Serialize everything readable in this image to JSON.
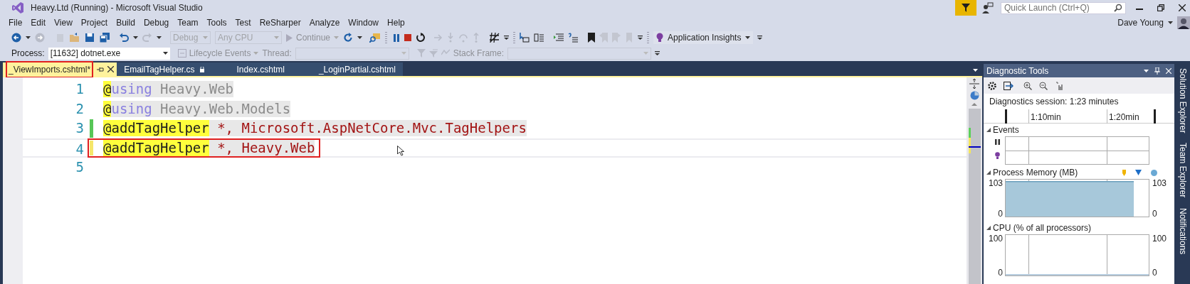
{
  "window": {
    "title": "Heavy.Ltd (Running) - Microsoft Visual Studio"
  },
  "quick_launch": {
    "placeholder": "Quick Launch (Ctrl+Q)"
  },
  "user": {
    "name": "Dave Young"
  },
  "menu": [
    "File",
    "Edit",
    "View",
    "Project",
    "Build",
    "Debug",
    "Team",
    "Tools",
    "Test",
    "ReSharper",
    "Analyze",
    "Window",
    "Help"
  ],
  "toolbar": {
    "configuration": "Debug",
    "platform": "Any CPU",
    "continue": "Continue",
    "insights": "Application Insights"
  },
  "debug_location": {
    "process_label": "Process:",
    "process": "[11632] dotnet.exe",
    "lifecycle": "Lifecycle Events",
    "thread_label": "Thread:",
    "stack_frame_label": "Stack Frame:"
  },
  "tabs": [
    {
      "label": "_ViewImports.cshtml*",
      "selected": true,
      "highlighted": true,
      "locked": false
    },
    {
      "label": "EmailTagHelper.cs",
      "selected": false,
      "highlighted": false,
      "locked": true
    },
    {
      "label": "Index.cshtml",
      "selected": false,
      "highlighted": false,
      "locked": false
    },
    {
      "label": "_LoginPartial.cshtml",
      "selected": false,
      "highlighted": false,
      "locked": false
    }
  ],
  "editor": {
    "lines": [
      {
        "number": "1",
        "highlighted": false,
        "tokens": [
          {
            "kind": "at",
            "text": "@"
          },
          {
            "kind": "keyword",
            "text": "using"
          },
          {
            "kind": "namespace",
            "text": " Heavy.Web"
          }
        ]
      },
      {
        "number": "2",
        "highlighted": false,
        "tokens": [
          {
            "kind": "at",
            "text": "@"
          },
          {
            "kind": "keyword",
            "text": "using"
          },
          {
            "kind": "namespace",
            "text": " Heavy.Web.Models"
          }
        ]
      },
      {
        "number": "3",
        "color": "#57c657",
        "highlighted": false,
        "tokens": [
          {
            "kind": "directive",
            "text": "@addTagHelper"
          },
          {
            "kind": "value",
            "text": " *, Microsoft.AspNetCore.Mvc.TagHelpers"
          }
        ]
      },
      {
        "number": "4",
        "color": "#f5e66a",
        "highlighted": true,
        "tokens": [
          {
            "kind": "directive",
            "text": "@addTagHelper"
          },
          {
            "kind": "value",
            "text": " *, Heavy.Web"
          }
        ]
      },
      {
        "number": "5",
        "highlighted": false
      }
    ]
  },
  "diagnostics": {
    "title": "Diagnostic Tools",
    "session": "Diagnostics session: 1:23 minutes",
    "timeline": [
      "1:10min",
      "1:20min"
    ],
    "events_label": "Events",
    "memory": {
      "label": "Process Memory (MB)",
      "left_max": "103",
      "left_min": "0",
      "right_max": "103",
      "right_min": "0"
    },
    "cpu": {
      "label": "CPU (% of all processors)",
      "left_max": "100",
      "left_min": "0",
      "right_max": "100",
      "right_min": "0"
    }
  },
  "side_tabs": [
    "Solution Explorer",
    "Team Explorer",
    "Notifications"
  ]
}
